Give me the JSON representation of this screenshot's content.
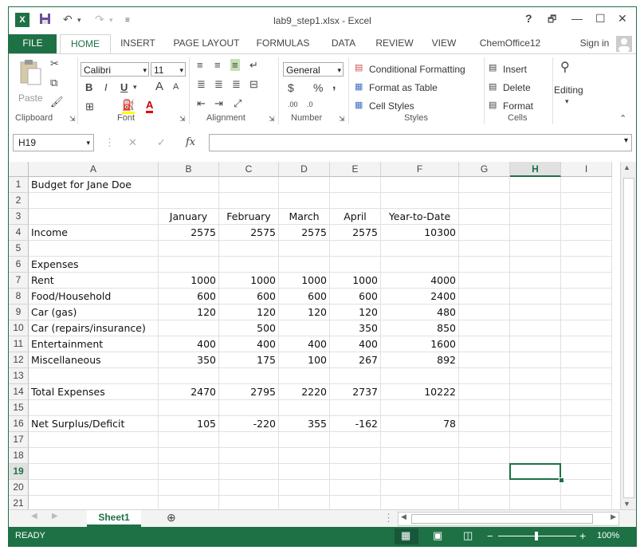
{
  "window": {
    "title": "lab9_step1.xlsx - Excel"
  },
  "titlebar": {
    "help": "?",
    "restore": "🗗",
    "minimize": "—",
    "maximize": "☐",
    "close": "✕"
  },
  "tabs": [
    {
      "label": "FILE"
    },
    {
      "label": "HOME"
    },
    {
      "label": "INSERT"
    },
    {
      "label": "PAGE LAYOUT"
    },
    {
      "label": "FORMULAS"
    },
    {
      "label": "DATA"
    },
    {
      "label": "REVIEW"
    },
    {
      "label": "VIEW"
    },
    {
      "label": "ChemOffice12"
    }
  ],
  "signin": "Sign in",
  "ribbon": {
    "clipboard": {
      "label": "Clipboard",
      "paste": "Paste"
    },
    "font": {
      "label": "Font",
      "name": "Calibri",
      "size": "11",
      "bold": "B",
      "italic": "I",
      "underline": "U",
      "grow": "A",
      "shrink": "A"
    },
    "alignment": {
      "label": "Alignment"
    },
    "number": {
      "label": "Number",
      "format": "General",
      "currency": "$",
      "percent": "%",
      "comma": ","
    },
    "styles": {
      "label": "Styles",
      "conditional": "Conditional Formatting",
      "table": "Format as Table",
      "cellstyles": "Cell Styles"
    },
    "cells": {
      "label": "Cells",
      "insert": "Insert",
      "delete": "Delete",
      "format": "Format"
    },
    "editing": {
      "label": "Editing"
    }
  },
  "formula_bar": {
    "name_box": "H19",
    "fx": "fx",
    "cancel": "✕",
    "enter": "✓",
    "value": ""
  },
  "columns": [
    "A",
    "B",
    "C",
    "D",
    "E",
    "F",
    "G",
    "H",
    "I"
  ],
  "rows": [
    {
      "n": "1",
      "cells": [
        "Budget for Jane Doe",
        "",
        "",
        "",
        "",
        ""
      ]
    },
    {
      "n": "2",
      "cells": [
        "",
        "",
        "",
        "",
        "",
        ""
      ]
    },
    {
      "n": "3",
      "cells": [
        "",
        "January",
        "February",
        "March",
        "April",
        "Year-to-Date"
      ]
    },
    {
      "n": "4",
      "cells": [
        "Income",
        "2575",
        "2575",
        "2575",
        "2575",
        "10300"
      ]
    },
    {
      "n": "5",
      "cells": [
        "",
        "",
        "",
        "",
        "",
        ""
      ]
    },
    {
      "n": "6",
      "cells": [
        "Expenses",
        "",
        "",
        "",
        "",
        ""
      ]
    },
    {
      "n": "7",
      "cells": [
        "Rent",
        "1000",
        "1000",
        "1000",
        "1000",
        "4000"
      ]
    },
    {
      "n": "8",
      "cells": [
        "Food/Household",
        "600",
        "600",
        "600",
        "600",
        "2400"
      ]
    },
    {
      "n": "9",
      "cells": [
        "Car (gas)",
        "120",
        "120",
        "120",
        "120",
        "480"
      ]
    },
    {
      "n": "10",
      "cells": [
        "Car (repairs/insurance)",
        "",
        "500",
        "",
        "350",
        "850"
      ]
    },
    {
      "n": "11",
      "cells": [
        "Entertainment",
        "400",
        "400",
        "400",
        "400",
        "1600"
      ]
    },
    {
      "n": "12",
      "cells": [
        "Miscellaneous",
        "350",
        "175",
        "100",
        "267",
        "892"
      ]
    },
    {
      "n": "13",
      "cells": [
        "",
        "",
        "",
        "",
        "",
        ""
      ]
    },
    {
      "n": "14",
      "cells": [
        "Total Expenses",
        "2470",
        "2795",
        "2220",
        "2737",
        "10222"
      ]
    },
    {
      "n": "15",
      "cells": [
        "",
        "",
        "",
        "",
        "",
        ""
      ]
    },
    {
      "n": "16",
      "cells": [
        "Net Surplus/Deficit",
        "105",
        "-220",
        "355",
        "-162",
        "78"
      ]
    },
    {
      "n": "17",
      "cells": [
        "",
        "",
        "",
        "",
        "",
        ""
      ]
    },
    {
      "n": "18",
      "cells": [
        "",
        "",
        "",
        "",
        "",
        ""
      ]
    },
    {
      "n": "19",
      "cells": [
        "",
        "",
        "",
        "",
        "",
        ""
      ]
    },
    {
      "n": "20",
      "cells": [
        "",
        "",
        "",
        "",
        "",
        ""
      ]
    },
    {
      "n": "21",
      "cells": [
        "",
        "",
        "",
        "",
        "",
        ""
      ]
    }
  ],
  "selected": {
    "col": "H",
    "row": "19"
  },
  "sheets": [
    {
      "label": "Sheet1"
    }
  ],
  "status": {
    "ready": "READY",
    "zoom": "100%",
    "zoom_minus": "−",
    "zoom_plus": "+"
  },
  "colors": {
    "accent": "#1e7145"
  }
}
